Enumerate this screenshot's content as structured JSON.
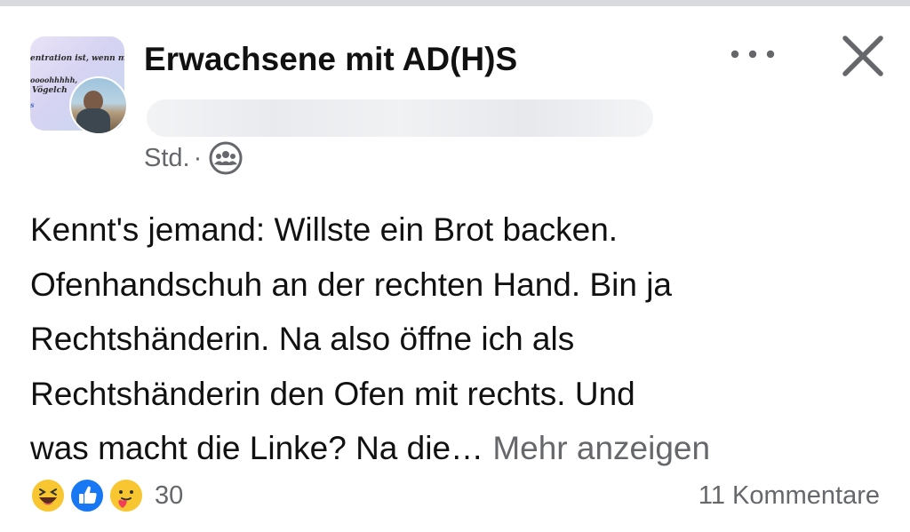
{
  "group": {
    "name": "Erwachsene mit AD(H)S",
    "avatar_lines": [
      "entration ist, wenn m",
      "oooohhhhh,",
      "Vögelch",
      "s"
    ]
  },
  "post": {
    "time": "Std.",
    "separator": "·",
    "audience_icon": "group-audience-icon",
    "text": "Kennt's jemand: Willste ein Brot backen.\nOfenhandschuh an der rechten Hand. Bin ja\nRechtshänderin. Na also öffne ich als\nRechtshänderin den Ofen mit rechts. Und\nwas macht die Linke? Na die… ",
    "see_more": "Mehr anzeigen"
  },
  "actions": {
    "more_icon": "more-options-icon",
    "close_icon": "close-icon"
  },
  "reactions": {
    "icons": [
      "laughing-reaction-icon",
      "like-reaction-icon",
      "care-reaction-icon"
    ],
    "count": "30"
  },
  "comments": {
    "count": "11",
    "label": "Kommentare"
  },
  "colors": {
    "text": "#111111",
    "muted": "#65676b",
    "like_blue": "#1877f2",
    "emoji_yellow": "#f7c630"
  }
}
